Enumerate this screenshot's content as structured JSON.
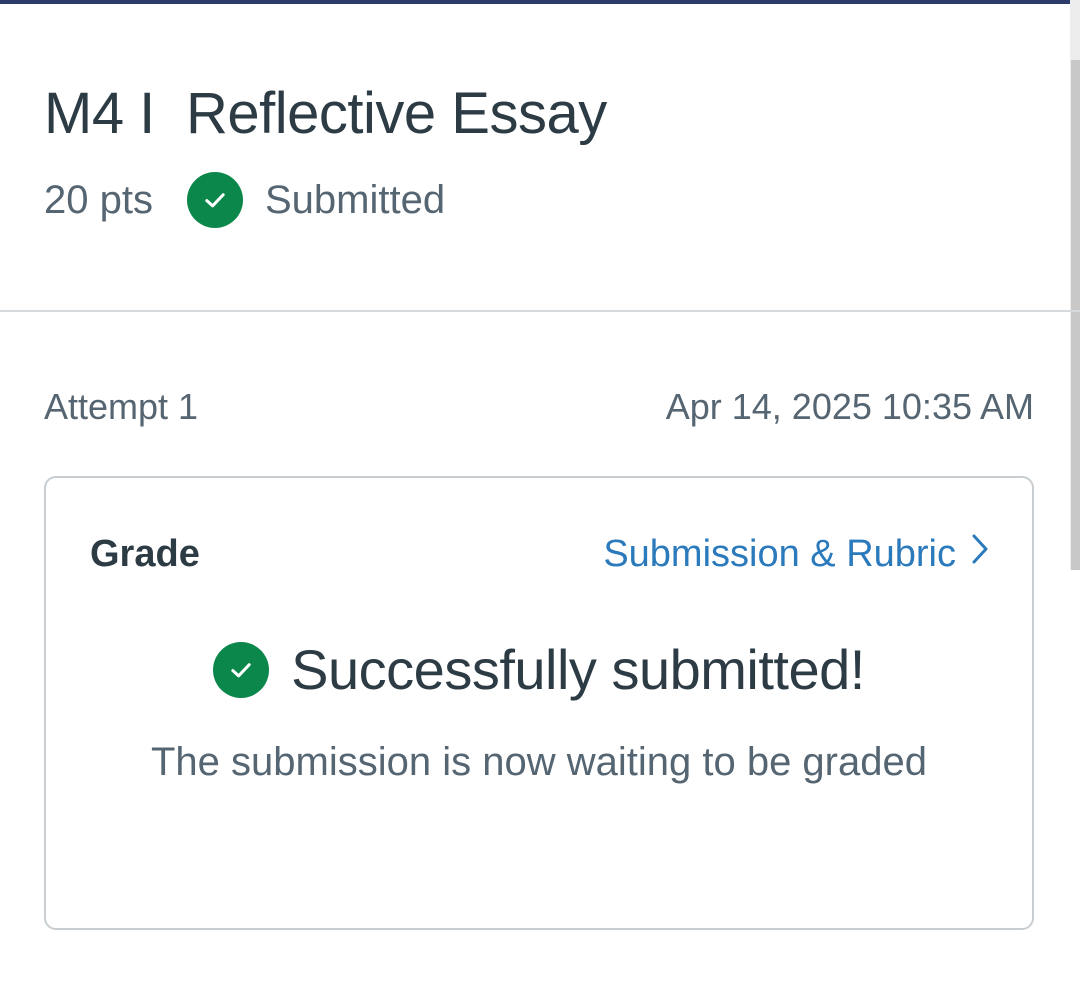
{
  "assignment": {
    "title": "M4 I  Reflective Essay",
    "points": "20 pts",
    "status": "Submitted",
    "status_icon": "check-circle-icon"
  },
  "attempt": {
    "label": "Attempt 1",
    "submitted_at": "Apr 14, 2025 10:35 AM"
  },
  "grade_card": {
    "heading": "Grade",
    "link_label": "Submission & Rubric",
    "link_icon": "chevron-right-icon",
    "success_title": "Successfully submitted!",
    "success_icon": "check-circle-icon",
    "message": "The submission is now waiting to be graded"
  },
  "colors": {
    "accent_bar": "#2d3b6b",
    "success_green": "#0b874b",
    "link_blue": "#2b7abc",
    "text_dark": "#2d3b45",
    "text_muted": "#556572"
  }
}
